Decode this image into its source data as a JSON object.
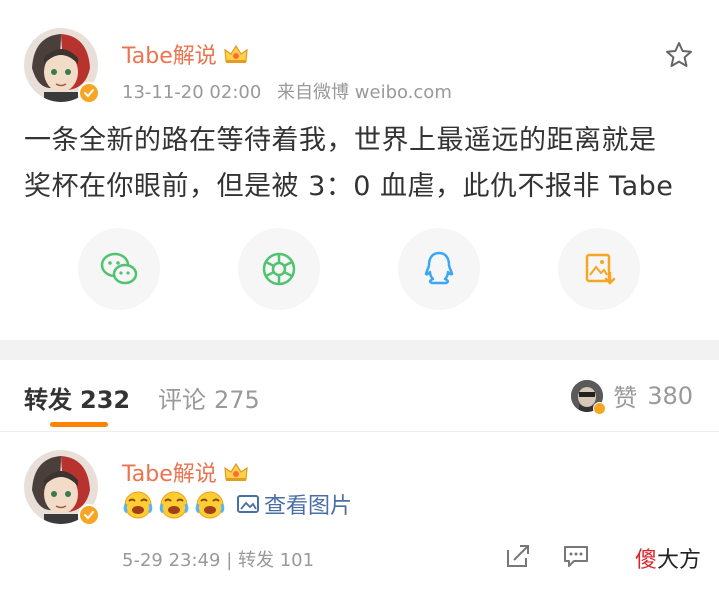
{
  "post": {
    "username": "Tabe解说",
    "timestamp": "13-11-20 02:00",
    "source": "来自微博 weibo.com",
    "content_line1": "一条全新的路在等待着我，世界上最遥远的距离就是",
    "content_line2": "奖杯在你眼前，但是被 3：0 血虐，此仇不报非 Tabe",
    "share_buttons": [
      "wechat-icon",
      "moments-icon",
      "qq-icon",
      "save-image-icon"
    ]
  },
  "tabs": {
    "repost_label": "转发",
    "repost_count": "232",
    "comment_label": "评论",
    "comment_count": "275",
    "like_label": "赞",
    "like_count": "380"
  },
  "comment": {
    "username": "Tabe解说",
    "view_image_label": "查看图片",
    "date": "5-29 23:49",
    "separator": "|",
    "repost_label": "转发",
    "repost_count": "101"
  },
  "watermark": {
    "part1": "傻",
    "part2": "大方"
  },
  "colors": {
    "username": "#eb7350",
    "accent_orange": "#ff8200",
    "link_blue": "#4a6fa5",
    "meta_gray": "#999999",
    "divider": "#f2f2f2"
  }
}
